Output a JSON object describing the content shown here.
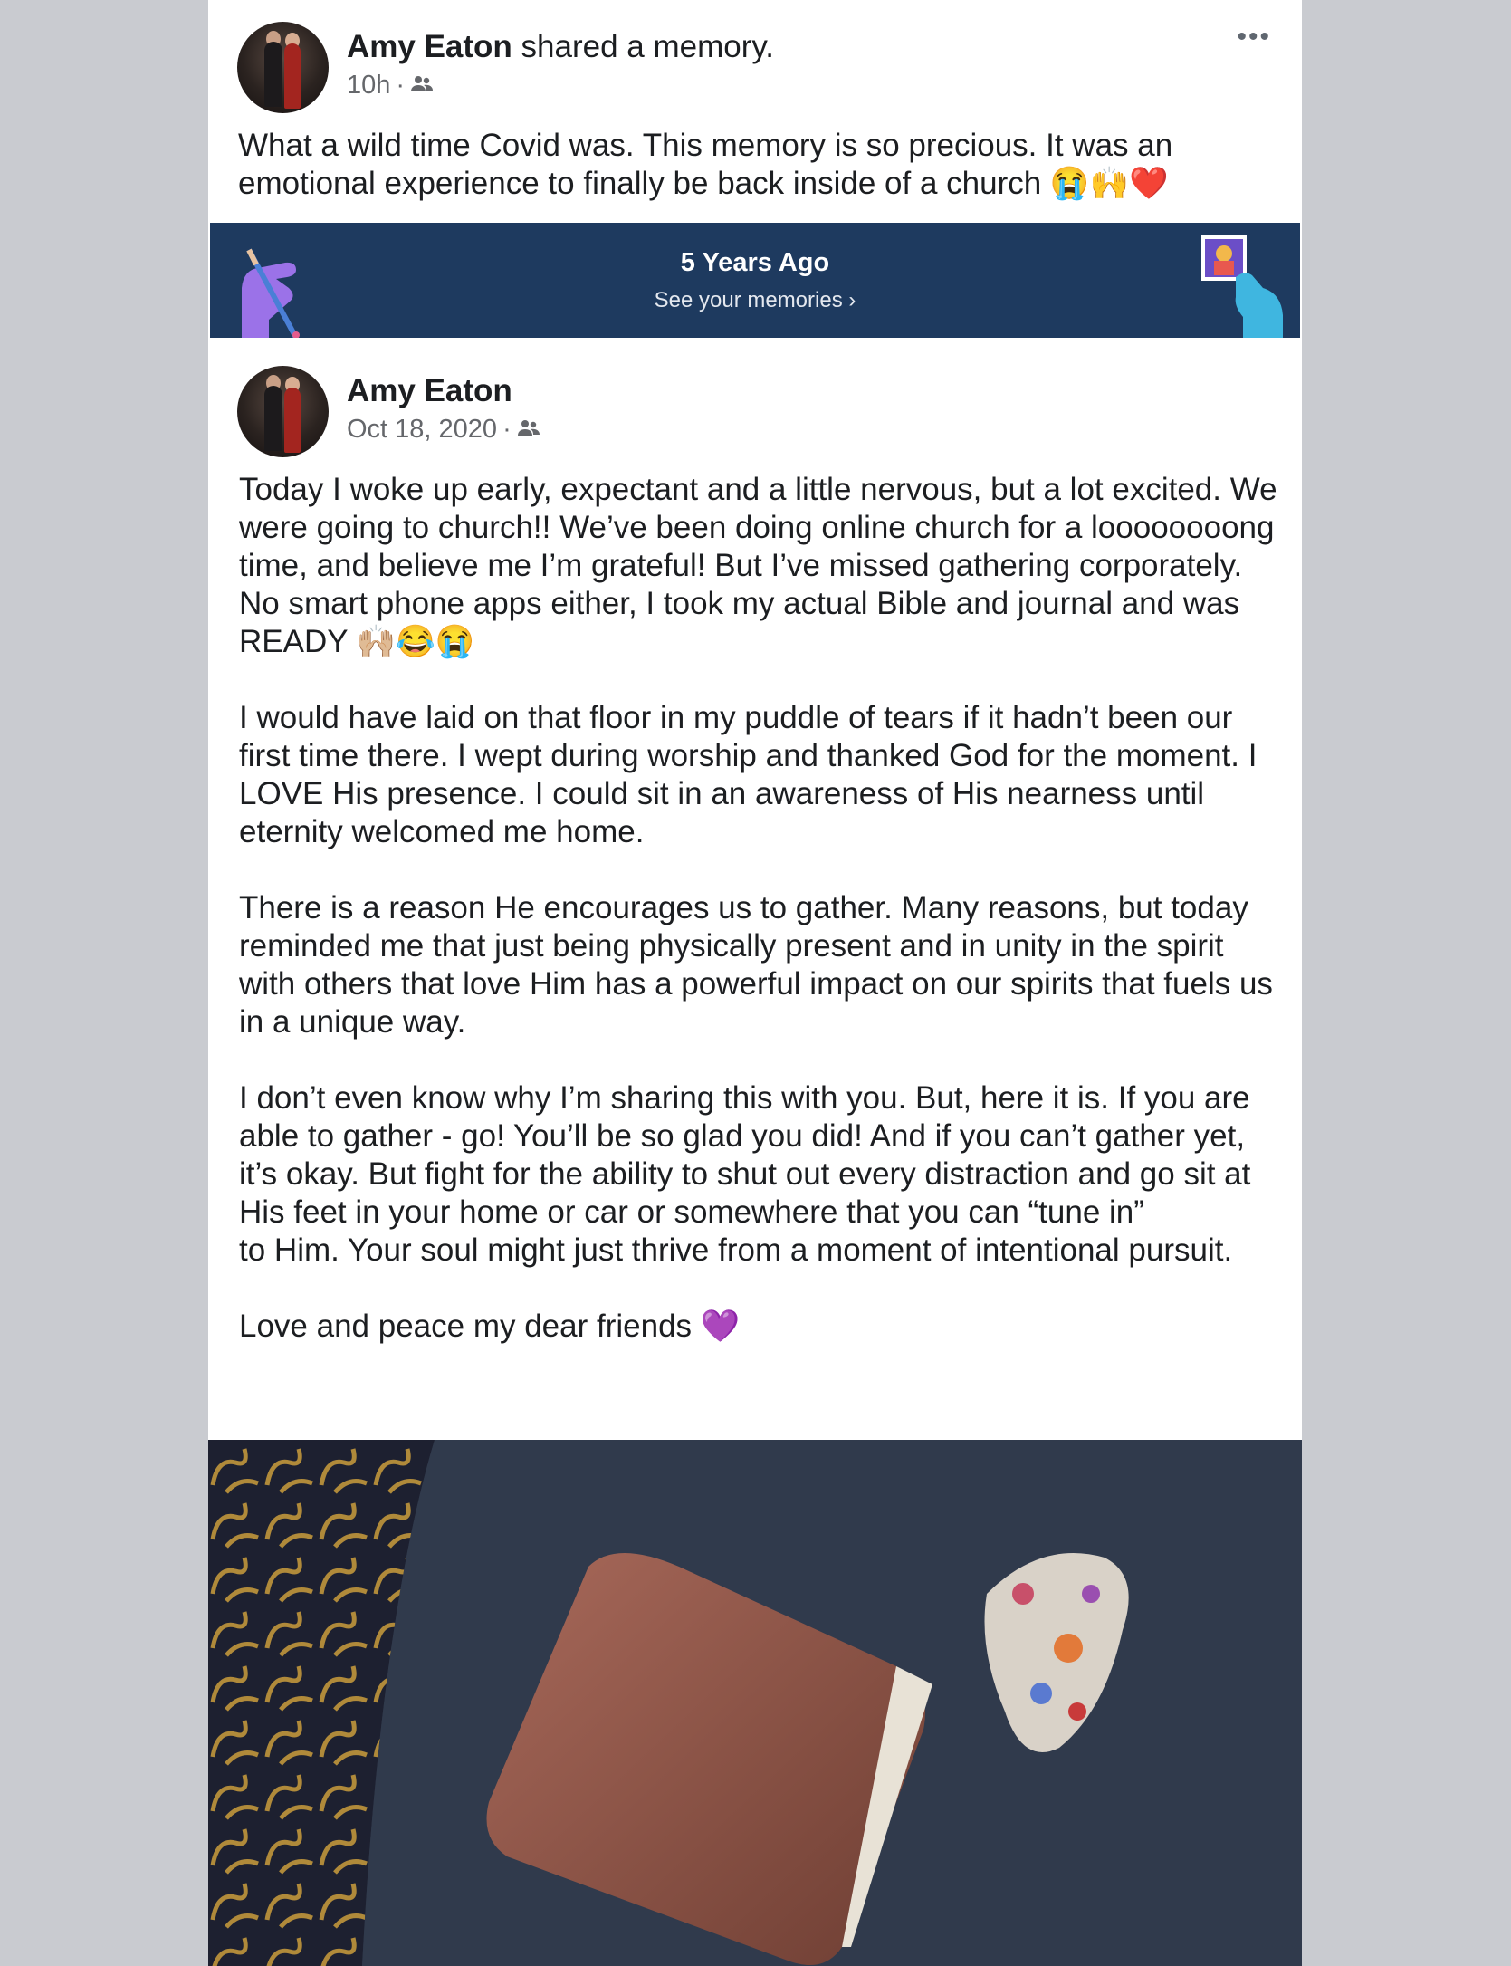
{
  "memory_post": {
    "author": "Amy Eaton",
    "action": "shared a memory.",
    "time": "10h",
    "audience_icon": "friends-icon",
    "more_label": "•••",
    "caption_line1": "What a wild time Covid was. This memory is so precious. It was an",
    "caption_line2": "emotional experience to finally be back inside of a church",
    "caption_emojis": "😭🙌❤️"
  },
  "banner": {
    "title": "5 Years Ago",
    "link": "See your memories",
    "link_chevron": "›",
    "bg_color": "#1e3a5f"
  },
  "original_post": {
    "author": "Amy Eaton",
    "date": "Oct 18, 2020",
    "audience_icon": "friends-icon",
    "paragraphs": [
      "Today I woke up early, expectant and a little nervous, but a lot excited. We were going to church!! We’ve been doing online church for a loooooooong time, and believe me I’m grateful! But I’ve missed gathering corporately. No smart phone apps either, I took my actual Bible and journal and was READY 🙌🏼😂😭",
      "I would have laid on that floor in my puddle of tears if it hadn’t been our first time there. I wept during worship and thanked God for the moment. I LOVE His presence. I could sit in an awareness of His nearness until eternity welcomed me home.",
      "There is a reason He encourages us to gather. Many reasons, but today reminded me that just being physically present and in unity in the spirit with others that love Him has a powerful impact on our spirits that fuels us in a unique way.",
      "I don’t even know why I’m sharing this with you. But, here it is. If you are able to gather - go! You’ll be so glad you did! And if you can’t gather yet, it’s okay. But fight for the ability to shut out every distraction and go sit at His feet in your home or car or somewhere that you can “tune in”",
      "to Him. Your soul might just thrive from a moment of intentional pursuit.",
      "Love and peace my dear friends 💜"
    ]
  },
  "photo": {
    "description_icon": "photo-bible-and-mask"
  }
}
